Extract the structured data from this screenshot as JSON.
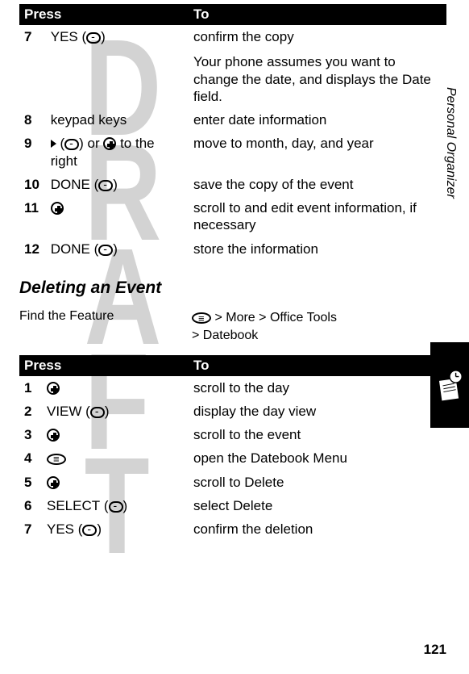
{
  "watermark": "DRAFT",
  "table1": {
    "header": {
      "col1": "Press",
      "col2": "To"
    },
    "rows": [
      {
        "num": "7",
        "key_bold": "YES",
        "key_paren": " (",
        "key_close": ")",
        "action": "confirm the copy",
        "sub": "Your phone assumes you want to change the date, and displays the ",
        "sub_bold": "Date",
        "sub_after": " field."
      },
      {
        "num": "8",
        "key": "keypad keys",
        "action": "enter date information"
      },
      {
        "num": "9",
        "key_paren": " (",
        "key_close": ") or ",
        "key_tail": " to the right",
        "action": "move to month, day, and year"
      },
      {
        "num": "10",
        "key_bold": "DONE",
        "key_paren": " (",
        "key_close": ")",
        "action": "save the copy of the event"
      },
      {
        "num": "11",
        "action": "scroll to and edit event information, if necessary"
      },
      {
        "num": "12",
        "key_bold": "DONE",
        "key_paren": " (",
        "key_close": ")",
        "action": "store the information"
      }
    ]
  },
  "section_heading": "Deleting an Event",
  "ftf": {
    "label": "Find the Feature",
    "gt1": ">",
    "more": "More",
    "gt2": ">",
    "office": "Office Tools",
    "gt3": ">",
    "datebook": "Datebook"
  },
  "table2": {
    "header": {
      "col1": "Press",
      "col2": "To"
    },
    "rows": [
      {
        "num": "1",
        "action": "scroll to the day"
      },
      {
        "num": "2",
        "key_bold": "VIEW",
        "key_paren": " (",
        "key_close": ")",
        "action": "display the day view"
      },
      {
        "num": "3",
        "action": "scroll to the event"
      },
      {
        "num": "4",
        "action": "open the ",
        "action_bold": "Datebook Menu"
      },
      {
        "num": "5",
        "action": "scroll to ",
        "action_bold": "Delete"
      },
      {
        "num": "6",
        "key_bold": "SELECT",
        "key_paren": " (",
        "key_close": ")",
        "action": "select ",
        "action_bold": "Delete"
      },
      {
        "num": "7",
        "key_bold": "YES",
        "key_paren": " (",
        "key_close": ")",
        "action": "confirm the deletion"
      }
    ]
  },
  "side_text": "Personal Organizer",
  "page_number": "121"
}
